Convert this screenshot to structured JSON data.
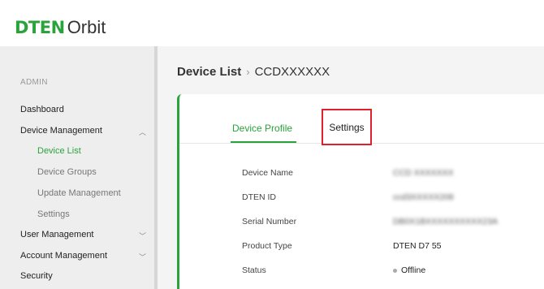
{
  "app": {
    "logo_brand": "DTEN",
    "logo_product": "Orbit"
  },
  "sidebar": {
    "section_heading": "ADMIN",
    "items": [
      {
        "label": "Dashboard"
      },
      {
        "label": "Device Management",
        "expanded": true
      },
      {
        "label": "User Management",
        "expanded": false
      },
      {
        "label": "Account Management",
        "expanded": false
      },
      {
        "label": "Security"
      }
    ],
    "device_management_children": [
      {
        "label": "Device List",
        "active": true
      },
      {
        "label": "Device Groups"
      },
      {
        "label": "Update Management"
      },
      {
        "label": "Settings"
      }
    ]
  },
  "breadcrumb": {
    "parent": "Device List",
    "separator": "›",
    "current": "CCDXXXXXX"
  },
  "tabs": [
    {
      "label": "Device Profile",
      "active": true
    },
    {
      "label": "Settings",
      "active": false,
      "highlighted": true
    }
  ],
  "device_profile": {
    "fields": [
      {
        "label": "Device Name",
        "value": "CCD XXXXXXX",
        "obscured": true
      },
      {
        "label": "DTEN ID",
        "value": "ccd3XXXXX208",
        "obscured": true
      },
      {
        "label": "Serial Number",
        "value": "DB0X1BXXXXXXXXXX23A",
        "obscured": true
      },
      {
        "label": "Product Type",
        "value": "DTEN D7 55"
      },
      {
        "label": "Status",
        "value": "Offline"
      }
    ]
  },
  "colors": {
    "accent": "#2aa33b",
    "highlight_box": "#e0202b",
    "sidebar_bg": "#eeeeee",
    "content_bg": "#f4f4f4"
  }
}
